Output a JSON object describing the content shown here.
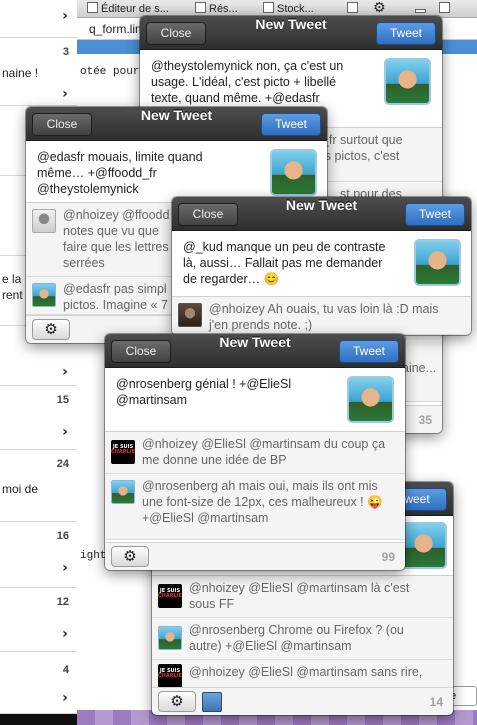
{
  "background": {
    "tabs": [
      "Éditeur de s...",
      "Rés...",
      "Stock..."
    ],
    "file_name": "q_form.line...",
    "left_numbers": [
      "3",
      "15",
      "24",
      "16",
      "12",
      "4"
    ],
    "left_fragments": [
      "naine !",
      "e la",
      "rent",
      "moi de"
    ],
    "code_lines": [
      "otée pour",
      "ight"
    ],
    "right_button": "ge"
  },
  "windows": [
    {
      "title": "New Tweet",
      "close_label": "Close",
      "tweet_label": "Tweet",
      "text_lines": [
        "@theystolemynick non, ça c'est un",
        "usage. L'idéal, c'est picto + libellé",
        "texte, quand même. +@edasfr"
      ],
      "replies": [
        {
          "lines": [
            "d_fr surtout que",
            "les pictos, c'est"
          ]
        },
        {
          "lines": [
            "st pour des"
          ]
        },
        {
          "lines": [
            "aine..."
          ]
        }
      ],
      "counter": "35"
    },
    {
      "title": "New Tweet",
      "close_label": "Close",
      "tweet_label": "Tweet",
      "text_lines": [
        "@edasfr mouais, limite quand",
        "même… +@ffoodd_fr",
        "@theystolemynick"
      ],
      "replies": [
        {
          "lines": [
            "@nhoizey @ffoodd",
            "notes que vu que",
            "faire que les lettres",
            "serrées"
          ]
        },
        {
          "lines": [
            "@edasfr pas simpl",
            "pictos. Imagine « 7"
          ]
        }
      ]
    },
    {
      "title": "New Tweet",
      "close_label": "Close",
      "tweet_label": "Tweet",
      "text_lines": [
        "@_kud manque un peu de contraste",
        "là, aussi… Fallait pas me demander",
        "de regarder… 😊"
      ],
      "replies": [
        {
          "lines": [
            "@nhoizey Ah ouais, tu vas loin là :D mais",
            "j'en prends note. ;)"
          ]
        }
      ]
    },
    {
      "title": "New Tweet",
      "close_label": "Close",
      "tweet_label": "Tweet",
      "text_lines": [
        "@nrosenberg génial ! +@ElieSl",
        "@martinsam"
      ],
      "replies": [
        {
          "lines": [
            "@nhoizey @ElieSl @martinsam du coup ça",
            "me donne une idée de BP"
          ]
        },
        {
          "lines": [
            "@nrosenberg ah mais oui, mais ils ont mis",
            "une font-size de 12px, ces malheureux ! 😜",
            "+@ElieSl @martinsam"
          ]
        }
      ],
      "counter": "99"
    },
    {
      "tweet_label": "weet",
      "replies": [
        {
          "lines": [
            "@nhoizey @ElieSl @martinsam là c'est",
            "sous FF"
          ]
        },
        {
          "lines": [
            "@nrosenberg Chrome ou Firefox ? (ou",
            "autre) +@ElieSl @martinsam"
          ]
        },
        {
          "lines": [
            "@nhoizey @ElieSl @martinsam sans rire,"
          ]
        }
      ],
      "counter": "14"
    }
  ],
  "avatar_badge": {
    "line1": "JE SUIS",
    "line2": "CHARLIE"
  },
  "icons": {
    "settings": "gear-icon"
  }
}
